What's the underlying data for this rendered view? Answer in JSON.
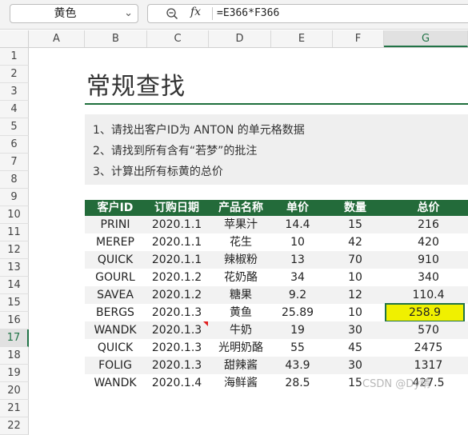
{
  "formula_bar": {
    "name_box": "黄色",
    "name_box_arrow": "⌄",
    "fx_label": "fx",
    "formula": "=E366*F366"
  },
  "columns": [
    "A",
    "B",
    "C",
    "D",
    "E",
    "F",
    "G"
  ],
  "selected_column": "G",
  "rows": [
    "1",
    "2",
    "3",
    "4",
    "5",
    "6",
    "7",
    "8",
    "9",
    "10",
    "11",
    "12",
    "13",
    "14",
    "15",
    "16",
    "17",
    "18",
    "19",
    "20",
    "21",
    "22"
  ],
  "selected_row": "17",
  "sheet": {
    "title": "常规查找",
    "instructions": [
      "1、请找出客户ID为 ANTON 的单元格数据",
      "2、请找到所有含有“若梦”的批注",
      "3、计算出所有标黄的总价"
    ],
    "table": {
      "headers": [
        "客户ID",
        "订购日期",
        "产品名称",
        "单价",
        "数量",
        "总价"
      ],
      "rows": [
        [
          "PRINI",
          "2020.1.1",
          "苹果汁",
          "14.4",
          "15",
          "216"
        ],
        [
          "MEREP",
          "2020.1.1",
          "花生",
          "10",
          "42",
          "420"
        ],
        [
          "QUICK",
          "2020.1.1",
          "辣椒粉",
          "13",
          "70",
          "910"
        ],
        [
          "GOURL",
          "2020.1.2",
          "花奶酪",
          "34",
          "10",
          "340"
        ],
        [
          "SAVEA",
          "2020.1.2",
          "糖果",
          "9.2",
          "12",
          "110.4"
        ],
        [
          "BERGS",
          "2020.1.3",
          "黄鱼",
          "25.89",
          "10",
          "258.9"
        ],
        [
          "WANDK",
          "2020.1.3",
          "牛奶",
          "19",
          "30",
          "570"
        ],
        [
          "QUICK",
          "2020.1.3",
          "光明奶酪",
          "55",
          "45",
          "2475"
        ],
        [
          "FOLIG",
          "2020.1.3",
          "甜辣酱",
          "43.9",
          "30",
          "1317"
        ],
        [
          "WANDK",
          "2020.1.4",
          "海鲜酱",
          "28.5",
          "15",
          "427.5"
        ]
      ],
      "highlight_color": "#f0f000"
    }
  },
  "watermark": "CSDN @Dy晴"
}
